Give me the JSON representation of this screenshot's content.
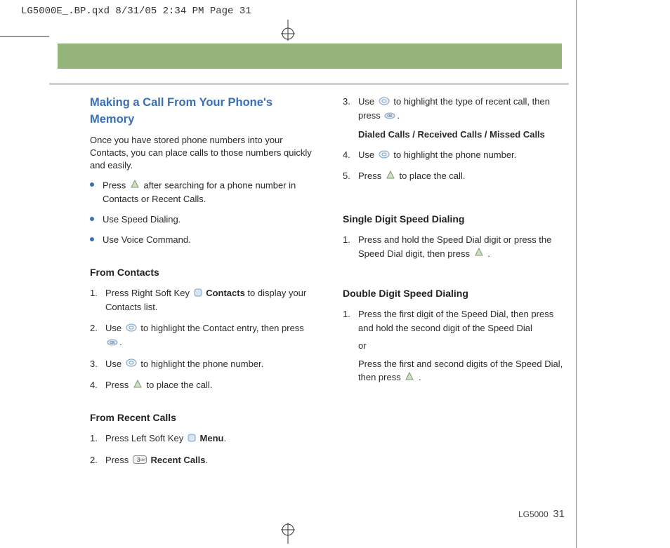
{
  "meta_header": "LG5000E_.BP.qxd  8/31/05  2:34 PM  Page 31",
  "title": "Making a Call From Your Phone's Memory",
  "intro": "Once you have stored phone numbers into your Contacts, you can place calls to those numbers quickly and easily.",
  "bullets": {
    "b1a": "Press ",
    "b1b": " after searching for a phone number in Contacts or Recent Calls.",
    "b2": "Use Speed Dialing.",
    "b3": "Use Voice Command."
  },
  "from_contacts": {
    "heading": "From Contacts",
    "s1a": "Press Right Soft Key ",
    "s1b": " Contacts",
    "s1c": " to display your Contacts list.",
    "s2a": "Use ",
    "s2b": " to highlight the Contact entry, then press ",
    "s2c": ".",
    "s3a": "Use ",
    "s3b": " to highlight  the phone number.",
    "s4a": "Press ",
    "s4b": " to place the call."
  },
  "from_recent": {
    "heading": "From Recent Calls",
    "s1a": "Press Left Soft Key ",
    "s1b": " Menu",
    "s1c": ".",
    "s2a": "Press ",
    "s2b": " Recent Calls",
    "s2c": "."
  },
  "right_col_cont": {
    "s3a": "Use ",
    "s3b": " to highlight the type of recent call, then press ",
    "s3c": ".",
    "s3sub": "Dialed Calls / Received Calls / Missed Calls",
    "s4a": "Use ",
    "s4b": " to highlight the phone number.",
    "s5a": "Press ",
    "s5b": " to place the call."
  },
  "single_digit": {
    "heading": "Single Digit Speed Dialing",
    "s1a": "Press and hold the Speed Dial digit or press the Speed Dial digit, then press ",
    "s1b": " ."
  },
  "double_digit": {
    "heading": "Double Digit Speed Dialing",
    "s1a": "Press the first digit of the Speed Dial, then press and hold the second digit of the Speed Dial",
    "s1or": "or",
    "s1b": "Press the first and second digits of the Speed Dial, then press ",
    "s1c": " ."
  },
  "footer": {
    "model": "LG5000",
    "page": "31"
  }
}
